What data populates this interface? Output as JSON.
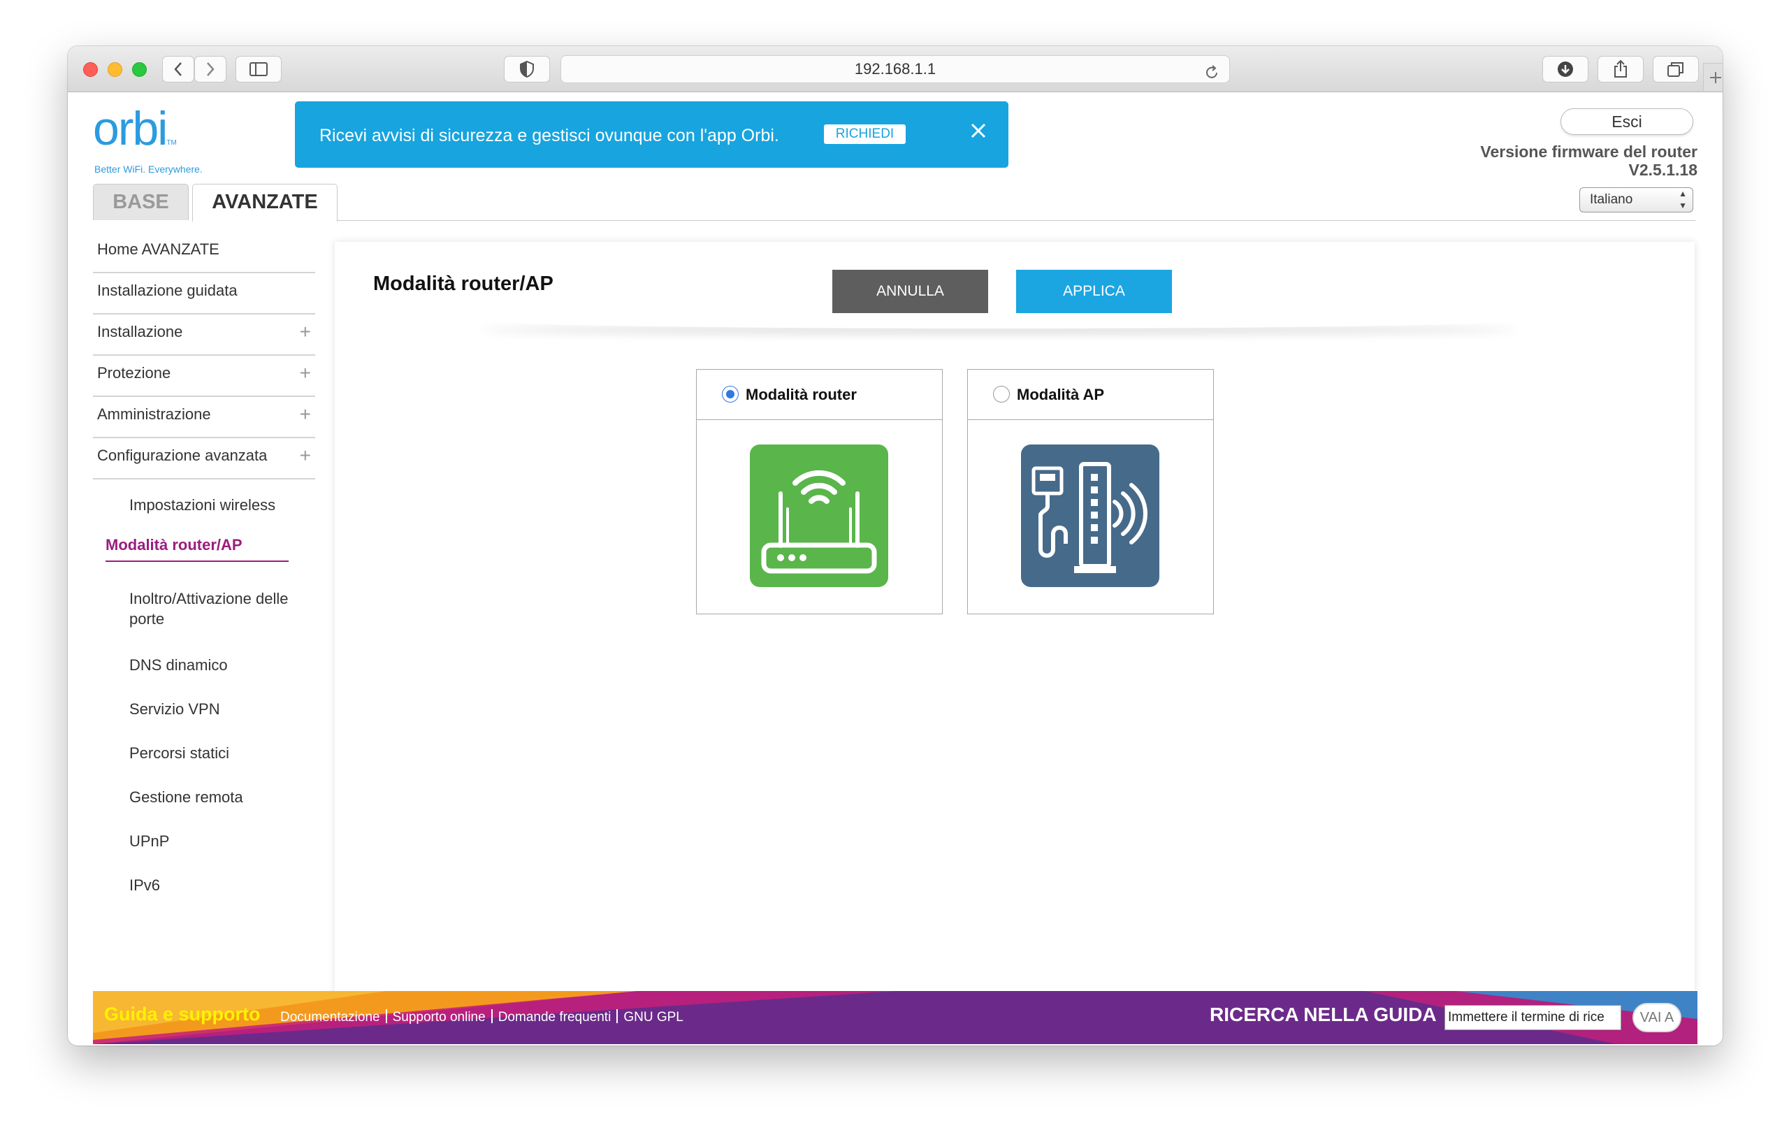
{
  "browser": {
    "url": "192.168.1.1",
    "buttons": [
      "back",
      "forward",
      "sidebar",
      "privacy",
      "reload",
      "downloads",
      "share",
      "tabs",
      "new-tab"
    ]
  },
  "header": {
    "logo_text": "orbi",
    "logo_tm": "TM",
    "tagline": "Better WiFi. Everywhere.",
    "banner": {
      "text": "Ricevi avvisi di sicurezza e gestisci ovunque con l'app Orbi.",
      "button": "RICHIEDI"
    },
    "logout": "Esci",
    "firmware_label": "Versione firmware del router",
    "firmware_version": "V2.5.1.18",
    "language": "Italiano"
  },
  "tabs": [
    {
      "label": "BASE",
      "active": false
    },
    {
      "label": "AVANZATE",
      "active": true
    }
  ],
  "sidebar": {
    "items": [
      {
        "label": "Home AVANZATE",
        "expandable": false
      },
      {
        "label": "Installazione guidata",
        "expandable": false
      },
      {
        "label": "Installazione",
        "expandable": true
      },
      {
        "label": "Protezione",
        "expandable": true
      },
      {
        "label": "Amministrazione",
        "expandable": true
      },
      {
        "label": "Configurazione avanzata",
        "expandable": true
      }
    ],
    "subitems": [
      {
        "label": "Impostazioni wireless"
      },
      {
        "label": "Modalità router/AP",
        "active": true
      },
      {
        "label": "Inoltro/Attivazione delle porte"
      },
      {
        "label": "DNS dinamico"
      },
      {
        "label": "Servizio VPN"
      },
      {
        "label": "Percorsi statici"
      },
      {
        "label": "Gestione remota"
      },
      {
        "label": "UPnP"
      },
      {
        "label": "IPv6"
      }
    ]
  },
  "main": {
    "title": "Modalità router/AP",
    "cancel_label": "ANNULLA",
    "apply_label": "APPLICA",
    "options": [
      {
        "label": "Modalità router",
        "selected": true,
        "icon": "router-icon",
        "color": "#5ab54b"
      },
      {
        "label": "Modalità AP",
        "selected": false,
        "icon": "access-point-icon",
        "color": "#466a8a"
      }
    ]
  },
  "footer": {
    "title": "Guida e supporto",
    "links": [
      "Documentazione",
      "Supporto online",
      "Domande frequenti",
      "GNU GPL"
    ],
    "search_label": "RICERCA NELLA GUIDA",
    "search_value": "Immettere il termine di rice",
    "go_label": "VAI A"
  },
  "colors": {
    "accent_blue": "#1ba6e2",
    "cancel_gray": "#5e5e5e",
    "active_nav": "#9b1d7e",
    "footer_purple": "#6b2a8a",
    "footer_orange": "#f39a1e",
    "footer_magenta": "#c41f7a"
  }
}
